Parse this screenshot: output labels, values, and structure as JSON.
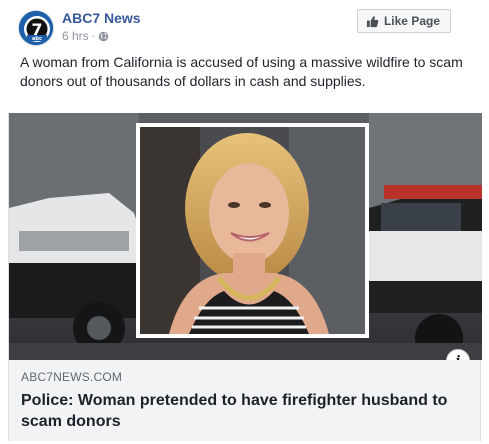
{
  "page": {
    "name": "ABC7 News",
    "time": "6 hrs",
    "separator": "·",
    "avatar_icon": "abc7-logo-icon",
    "avatar_logo_text": "7",
    "avatar_logo_subtext": "abc",
    "globe_icon": "globe-icon"
  },
  "like_button": {
    "label": "Like Page",
    "icon": "thumbs-up-icon"
  },
  "post": {
    "text": "A woman from California is accused of using a massive wildfire to scam donors out of thousands of dollars in cash and supplies."
  },
  "link_preview": {
    "image_icon": "news-photo",
    "info_label": "i",
    "domain": "ABC7NEWS.COM",
    "headline": "Police: Woman pretended to have firefighter husband to scam donors"
  },
  "colors": {
    "link_blue": "#365899",
    "text": "#1d2129",
    "muted": "#90949c",
    "preview_bg": "#f2f3f5"
  }
}
